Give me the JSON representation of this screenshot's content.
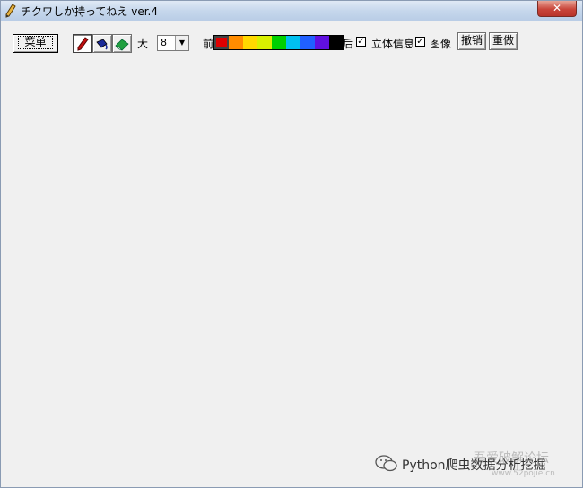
{
  "window": {
    "title": "チクワしか持ってねえ ver.4",
    "close_label": "✕",
    "icon": "pencil-icon"
  },
  "toolbar": {
    "menu_label": "菜单",
    "tools": [
      {
        "name": "pen-tool",
        "icon": "pen-icon",
        "pressed": true
      },
      {
        "name": "bucket-tool",
        "icon": "paint-bucket-icon",
        "pressed": false
      },
      {
        "name": "eraser-tool",
        "icon": "eraser-icon",
        "pressed": false
      }
    ],
    "size_label": "大",
    "size_value": "8",
    "fg_label": "前",
    "bg_label": "后",
    "palette": [
      "#e00000",
      "#ff8c00",
      "#ffd800",
      "#d8f000",
      "#00d000",
      "#00c0f0",
      "#2060ff",
      "#6010e0",
      "#000000"
    ],
    "selected_color": "#e00000",
    "stereo_label": "立体信息",
    "stereo_checked": true,
    "image_label": "图像",
    "image_checked": true,
    "undo_label": "撤销",
    "redo_label": "重做"
  },
  "watermark": {
    "text": "Python爬虫数据分析挖掘",
    "background_text": "吾爱破解论坛",
    "url": "www.52pojie.cn"
  }
}
